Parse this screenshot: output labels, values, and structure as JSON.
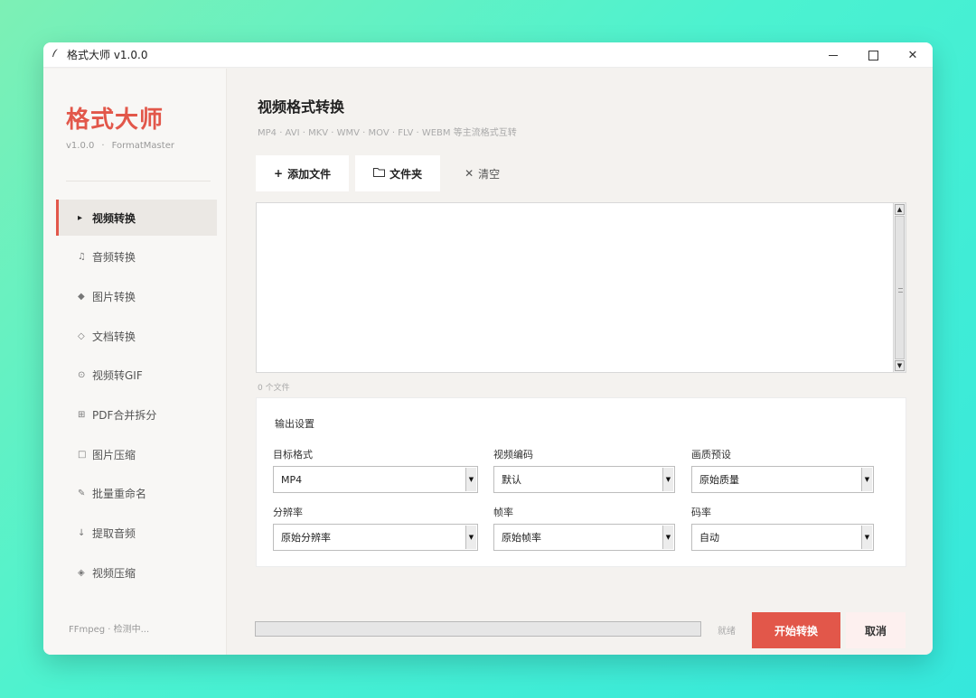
{
  "window": {
    "title": "格式大师 v1.0.0",
    "title_icon": "feather-icon",
    "controls": [
      "minimize",
      "maximize",
      "close"
    ],
    "close_glyph": "✕"
  },
  "sidebar": {
    "brand": "格式大师",
    "version": "v1.0.0",
    "separator": "·",
    "brand_en": "FormatMaster",
    "items": [
      {
        "icon": "▸",
        "label": "视频转换",
        "active": true
      },
      {
        "icon": "♫",
        "label": "音频转换"
      },
      {
        "icon": "◆",
        "label": "图片转换"
      },
      {
        "icon": "◇",
        "label": "文档转换"
      },
      {
        "icon": "⊙",
        "label": "视频转GIF"
      },
      {
        "icon": "⊞",
        "label": "PDF合并拆分"
      },
      {
        "icon": "□",
        "label": "图片压缩"
      },
      {
        "icon": "✎",
        "label": "批量重命名"
      },
      {
        "icon": "↓",
        "label": "提取音频"
      },
      {
        "icon": "◈",
        "label": "视频压缩"
      }
    ],
    "status": "FFmpeg · 检测中..."
  },
  "main": {
    "title": "视频格式转换",
    "subtitle": "MP4 · AVI · MKV · WMV · MOV · FLV · WEBM 等主流格式互转",
    "toolbar": {
      "add_icon": "+",
      "add_label": "添加文件",
      "folder_label": "文件夹",
      "clear_icon": "✕",
      "clear_label": "清空"
    },
    "file_count": "0 个文件",
    "settings": {
      "title": "输出设置",
      "fields": {
        "format": {
          "label": "目标格式",
          "value": "MP4"
        },
        "codec": {
          "label": "视频编码",
          "value": "默认"
        },
        "quality": {
          "label": "画质预设",
          "value": "原始质量"
        },
        "resolution": {
          "label": "分辨率",
          "value": "原始分辨率"
        },
        "fps": {
          "label": "帧率",
          "value": "原始帧率"
        },
        "bitrate": {
          "label": "码率",
          "value": "自动"
        }
      }
    },
    "progress": {
      "value": 0
    },
    "status": "就绪",
    "start_label": "开始转换",
    "cancel_label": "取消"
  },
  "colors": {
    "accent": "#e2574a",
    "cancel_bg": "#fdf0ef",
    "window_bg": "#f4f2ef",
    "sidebar_bg": "#f8f7f5"
  }
}
